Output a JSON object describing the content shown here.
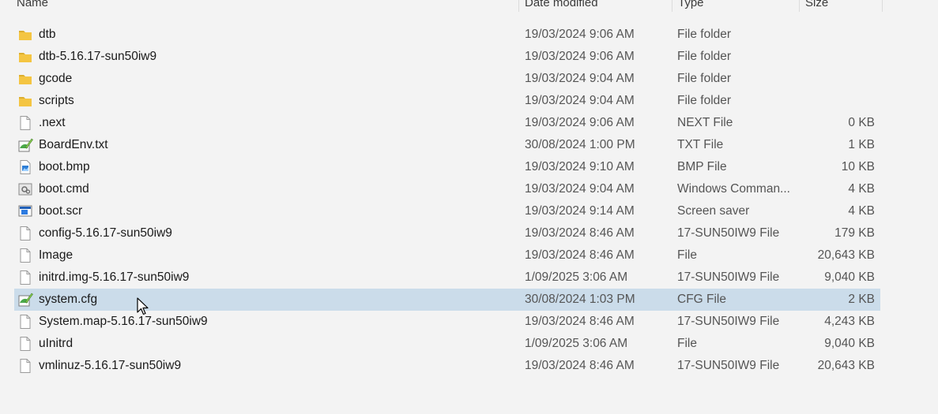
{
  "columns": {
    "name": "Name",
    "date_modified": "Date modified",
    "type": "Type",
    "size": "Size"
  },
  "files": [
    {
      "name": "dtb",
      "date": "19/03/2024 9:06 AM",
      "type": "File folder",
      "size": "",
      "icon": "folder-icon"
    },
    {
      "name": "dtb-5.16.17-sun50iw9",
      "date": "19/03/2024 9:06 AM",
      "type": "File folder",
      "size": "",
      "icon": "folder-icon"
    },
    {
      "name": "gcode",
      "date": "19/03/2024 9:04 AM",
      "type": "File folder",
      "size": "",
      "icon": "folder-icon"
    },
    {
      "name": "scripts",
      "date": "19/03/2024 9:04 AM",
      "type": "File folder",
      "size": "",
      "icon": "folder-icon"
    },
    {
      "name": ".next",
      "date": "19/03/2024 9:06 AM",
      "type": "NEXT File",
      "size": "0 KB",
      "icon": "blank-file-icon"
    },
    {
      "name": "BoardEnv.txt",
      "date": "30/08/2024 1:00 PM",
      "type": "TXT File",
      "size": "1 KB",
      "icon": "text-editor-file-icon"
    },
    {
      "name": "boot.bmp",
      "date": "19/03/2024 9:10 AM",
      "type": "BMP File",
      "size": "10 KB",
      "icon": "image-file-icon"
    },
    {
      "name": "boot.cmd",
      "date": "19/03/2024 9:04 AM",
      "type": "Windows Comman...",
      "size": "4 KB",
      "icon": "command-file-icon"
    },
    {
      "name": "boot.scr",
      "date": "19/03/2024 9:14 AM",
      "type": "Screen saver",
      "size": "4 KB",
      "icon": "screensaver-file-icon"
    },
    {
      "name": "config-5.16.17-sun50iw9",
      "date": "19/03/2024 8:46 AM",
      "type": "17-SUN50IW9 File",
      "size": "179 KB",
      "icon": "blank-file-icon"
    },
    {
      "name": "Image",
      "date": "19/03/2024 8:46 AM",
      "type": "File",
      "size": "20,643 KB",
      "icon": "blank-file-icon"
    },
    {
      "name": "initrd.img-5.16.17-sun50iw9",
      "date": "1/09/2025 3:06 AM",
      "type": "17-SUN50IW9 File",
      "size": "9,040 KB",
      "icon": "blank-file-icon"
    },
    {
      "name": "system.cfg",
      "date": "30/08/2024 1:03 PM",
      "type": "CFG File",
      "size": "2 KB",
      "icon": "text-editor-file-icon",
      "selected": true
    },
    {
      "name": "System.map-5.16.17-sun50iw9",
      "date": "19/03/2024 8:46 AM",
      "type": "17-SUN50IW9 File",
      "size": "4,243 KB",
      "icon": "blank-file-icon"
    },
    {
      "name": "uInitrd",
      "date": "1/09/2025 3:06 AM",
      "type": "File",
      "size": "9,040 KB",
      "icon": "blank-file-icon"
    },
    {
      "name": "vmlinuz-5.16.17-sun50iw9",
      "date": "19/03/2024 8:46 AM",
      "type": "17-SUN50IW9 File",
      "size": "20,643 KB",
      "icon": "blank-file-icon"
    }
  ],
  "colors": {
    "background": "#f3f3f3",
    "selection": "#cbdcea",
    "folder": "#f4c542",
    "secondary_text": "#555555"
  }
}
